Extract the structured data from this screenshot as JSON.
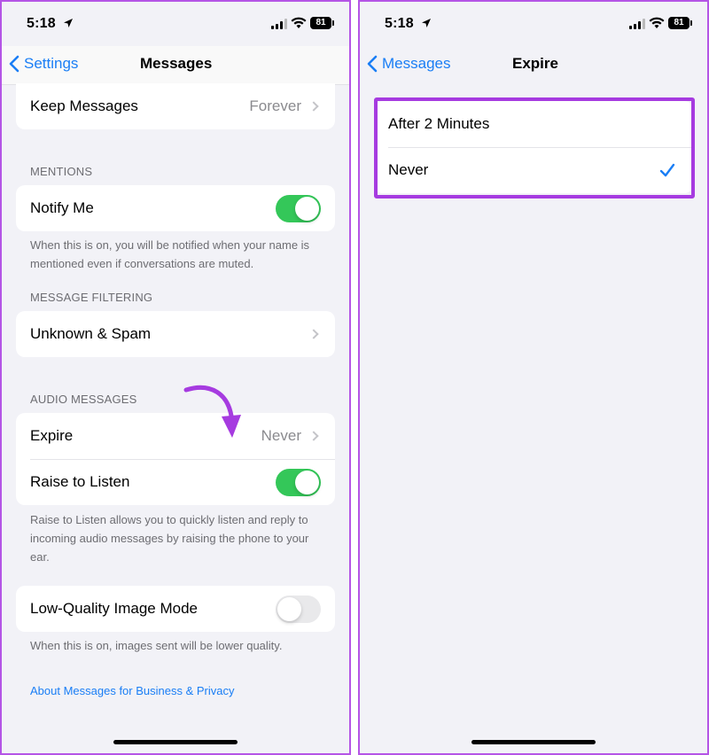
{
  "left": {
    "status": {
      "time": "5:18",
      "battery": "81"
    },
    "nav": {
      "back_label": "Settings",
      "title": "Messages"
    },
    "keep_messages": {
      "label": "Keep Messages",
      "value": "Forever"
    },
    "mentions": {
      "header": "MENTIONS",
      "notify_label": "Notify Me",
      "notify_on": true,
      "footer": "When this is on, you will be notified when your name is mentioned even if conversations are muted."
    },
    "filtering": {
      "header": "MESSAGE FILTERING",
      "unknown_label": "Unknown & Spam"
    },
    "audio": {
      "header": "AUDIO MESSAGES",
      "expire_label": "Expire",
      "expire_value": "Never",
      "raise_label": "Raise to Listen",
      "raise_on": true,
      "footer": "Raise to Listen allows you to quickly listen and reply to incoming audio messages by raising the phone to your ear."
    },
    "low_quality": {
      "label": "Low-Quality Image Mode",
      "on": false,
      "footer": "When this is on, images sent will be lower quality."
    },
    "about_link": "About Messages for Business & Privacy"
  },
  "right": {
    "status": {
      "time": "5:18",
      "battery": "81"
    },
    "nav": {
      "back_label": "Messages",
      "title": "Expire"
    },
    "options": [
      {
        "label": "After 2 Minutes",
        "selected": false
      },
      {
        "label": "Never",
        "selected": true
      }
    ]
  },
  "colors": {
    "accent": "#1a7ef5",
    "toggle_on": "#34c759",
    "annotation": "#a63be0",
    "panel_border": "#b455e6"
  },
  "icons": [
    "location-arrow-icon",
    "signal-icon",
    "wifi-icon",
    "battery-icon",
    "back-chevron-icon",
    "chevron-right-icon",
    "checkmark-icon",
    "annotation-arrow-icon"
  ]
}
